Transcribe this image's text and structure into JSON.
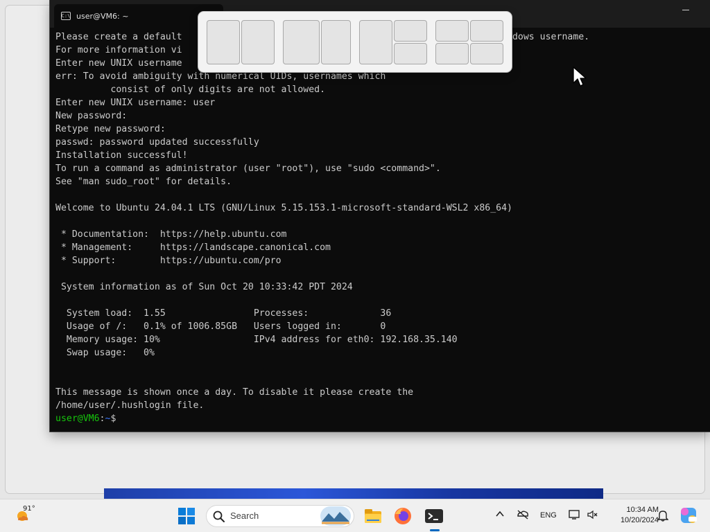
{
  "terminal": {
    "tab_title": "user@VM6: ~",
    "tab_icon_text": "C:\\",
    "lines": [
      "Please create a default                                              match your Windows username.",
      "For more information vi",
      "Enter new UNIX username",
      "err: To avoid ambiguity with numerical UIDs, usernames which",
      "          consist of only digits are not allowed.",
      "Enter new UNIX username: user",
      "New password:",
      "Retype new password:",
      "passwd: password updated successfully",
      "Installation successful!",
      "To run a command as administrator (user \"root\"), use \"sudo <command>\".",
      "See \"man sudo_root\" for details.",
      "",
      "Welcome to Ubuntu 24.04.1 LTS (GNU/Linux 5.15.153.1-microsoft-standard-WSL2 x86_64)",
      "",
      " * Documentation:  https://help.ubuntu.com",
      " * Management:     https://landscape.canonical.com",
      " * Support:        https://ubuntu.com/pro",
      "",
      " System information as of Sun Oct 20 10:33:42 PDT 2024",
      "",
      "  System load:  1.55                Processes:             36",
      "  Usage of /:   0.1% of 1006.85GB   Users logged in:       0",
      "  Memory usage: 10%                 IPv4 address for eth0: 192.168.35.140",
      "  Swap usage:   0%",
      "",
      "",
      "This message is shown once a day. To disable it please create the",
      "/home/user/.hushlogin file."
    ],
    "prompt_user": "user@VM6",
    "prompt_sep": ":",
    "prompt_path": "~",
    "prompt_symbol": "$"
  },
  "snap_layouts": {
    "layouts": [
      {
        "name": "two-halves"
      },
      {
        "name": "two-thirds-left"
      },
      {
        "name": "left-half-right-stack"
      },
      {
        "name": "four-quadrants"
      }
    ]
  },
  "taskbar": {
    "weather_temp": "91°",
    "weather_icon": "sun-cloud-icon",
    "search_placeholder": "Search",
    "apps": [
      "start-icon",
      "file-explorer-icon",
      "firefox-icon",
      "terminal-icon"
    ],
    "tray": {
      "language": "ENG",
      "time": "10:34 AM",
      "date": "10/20/2024"
    }
  },
  "colors": {
    "terminal_bg": "#0c0c0c",
    "terminal_text": "#cccccc",
    "prompt_green": "#16c60c",
    "prompt_blue": "#3b78ff",
    "accent": "#0067c0"
  }
}
